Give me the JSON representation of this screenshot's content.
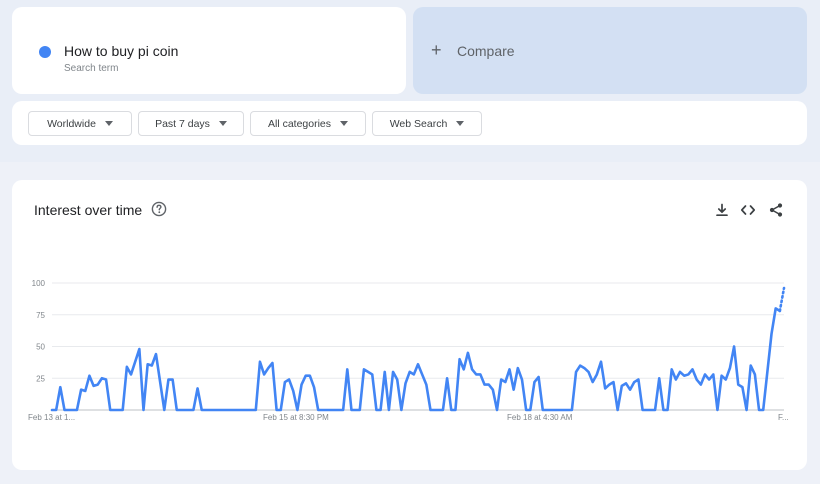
{
  "search_term": {
    "title": "How to buy pi coin",
    "subtitle": "Search term",
    "color": "#4285f4"
  },
  "compare": {
    "plus": "+",
    "label": "Compare"
  },
  "filters": [
    {
      "label": "Worldwide"
    },
    {
      "label": "Past 7 days"
    },
    {
      "label": "All categories"
    },
    {
      "label": "Web Search"
    }
  ],
  "chart": {
    "title": "Interest over time",
    "icons": [
      "help-icon",
      "download-icon",
      "embed-icon",
      "share-icon"
    ]
  },
  "chart_data": {
    "type": "line",
    "title": "Interest over time",
    "xlabel": "",
    "ylabel": "",
    "ylim": [
      0,
      100
    ],
    "yticks": [
      25,
      50,
      75,
      100
    ],
    "grid": true,
    "xtick_labels": [
      "Feb 13 at 1...",
      "Feb 15 at 8:30 PM",
      "Feb 18 at 4:30 AM",
      "F..."
    ],
    "series": [
      {
        "color": "#4285f4",
        "values": [
          0,
          0,
          18,
          0,
          0,
          0,
          0,
          16,
          15,
          27,
          19,
          20,
          25,
          24,
          0,
          0,
          0,
          0,
          34,
          28,
          38,
          48,
          0,
          36,
          35,
          44,
          22,
          0,
          24,
          24,
          0,
          0,
          0,
          0,
          0,
          17,
          0,
          0,
          0,
          0,
          0,
          0,
          0,
          0,
          0,
          0,
          0,
          0,
          0,
          0,
          38,
          28,
          33,
          37,
          0,
          0,
          22,
          24,
          15,
          0,
          20,
          27,
          27,
          18,
          0,
          0,
          0,
          0,
          0,
          0,
          0,
          32,
          0,
          0,
          0,
          32,
          30,
          28,
          0,
          0,
          30,
          0,
          30,
          24,
          0,
          21,
          30,
          28,
          36,
          28,
          20,
          0,
          0,
          0,
          0,
          25,
          0,
          0,
          40,
          32,
          45,
          32,
          28,
          28,
          20,
          20,
          16,
          0,
          24,
          22,
          32,
          16,
          33,
          24,
          0,
          0,
          22,
          26,
          0,
          0,
          0,
          0,
          0,
          0,
          0,
          0,
          30,
          35,
          33,
          30,
          22,
          28,
          38,
          17,
          20,
          22,
          0,
          19,
          21,
          16,
          22,
          24,
          0,
          0,
          0,
          0,
          25,
          0,
          0,
          32,
          24,
          30,
          27,
          28,
          32,
          24,
          20,
          28,
          24,
          28,
          0,
          27,
          24,
          33,
          50,
          20,
          18,
          0,
          35,
          28,
          0,
          0,
          30,
          60,
          80,
          78
        ],
        "dotted_tail": [
          78,
          96
        ]
      }
    ]
  }
}
